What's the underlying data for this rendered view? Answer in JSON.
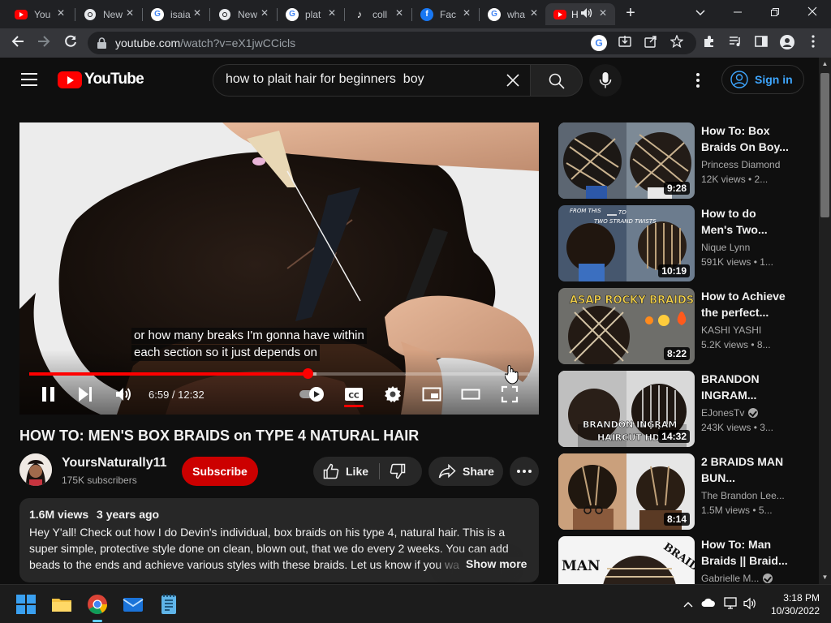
{
  "browser": {
    "tabs": [
      {
        "title": "You",
        "icon": "youtube-icon",
        "color": "#ff0000"
      },
      {
        "title": "New",
        "icon": "chrome-icon",
        "color": "#ffffff"
      },
      {
        "title": "isaia",
        "icon": "google-icon",
        "color": "#ffffff"
      },
      {
        "title": "New",
        "icon": "chrome-icon",
        "color": "#ffffff"
      },
      {
        "title": "plat",
        "icon": "google-icon",
        "color": "#ffffff"
      },
      {
        "title": "coll",
        "icon": "tiktok-icon",
        "color": "#ffffff"
      },
      {
        "title": "Fac",
        "icon": "facebook-icon",
        "color": "#1877f2"
      },
      {
        "title": "wha",
        "icon": "google-icon",
        "color": "#ffffff"
      },
      {
        "title": "H",
        "icon": "youtube-icon",
        "color": "#ff0000",
        "active": true
      }
    ],
    "url_host": "youtube.com",
    "url_path": "/watch?v=eX1jwCCicls"
  },
  "youtube": {
    "logo_text": "YouTube",
    "search_value": "how to plait hair for beginners  boy",
    "sign_in": "Sign in"
  },
  "player": {
    "caption_line1": "or how many breaks I'm gonna have within",
    "caption_line2": "each section so it just depends on",
    "current_time": "6:59",
    "duration": "12:32",
    "time_display": "6:59 / 12:32",
    "played_fraction": 0.557,
    "loaded_fraction": 0.575
  },
  "video": {
    "title": "HOW TO: MEN'S BOX BRAIDS on TYPE 4 NATURAL HAIR",
    "channel": "YoursNaturally11",
    "subscribers": "175K subscribers",
    "subscribe_label": "Subscribe",
    "like_label": "Like",
    "share_label": "Share",
    "views": "1.6M views",
    "age": "3 years ago",
    "description": "Hey Y'all! Check out how I do Devin's individual, box braids on his type 4, natural hair. This is a super simple, protective style done on clean, blown out, that we do every 2 weeks. You can add beads to the ends and achieve various styles with these braids. Let us know if you want to see h",
    "show_more": "Show more"
  },
  "recommendations": [
    {
      "title": "How To: Box Braids On Boy...",
      "channel": "Princess Diamond",
      "stats": "12K views  • 2...",
      "duration": "9:28",
      "verified": false
    },
    {
      "title": "How to do Men's Two...",
      "channel": "Nique Lynn",
      "stats": "591K views  • 1...",
      "duration": "10:19",
      "verified": false,
      "thumb_text1": "FROM THIS",
      "thumb_text2": "TO",
      "thumb_text3": "TWO STRAND TWISTS"
    },
    {
      "title": "How to Achieve the perfect...",
      "channel": "KASHI YASHI",
      "stats": "5.2K views  • 8...",
      "duration": "8:22",
      "verified": false,
      "thumb_text1": "ASAP ROCKY BRAIDS"
    },
    {
      "title": "BRANDON INGRAM...",
      "channel": "EJonesTv",
      "stats": "243K views  • 3...",
      "duration": "14:32",
      "verified": true,
      "thumb_text1": "BRANDON INGRAM",
      "thumb_text2": "HAIRCUT HD !"
    },
    {
      "title": "2 BRAIDS MAN BUN...",
      "channel": "The Brandon Lee...",
      "stats": "1.5M views  • 5...",
      "duration": "8:14",
      "verified": false
    },
    {
      "title": "How To: Man Braids || Braid...",
      "channel": "Gabrielle M...",
      "stats": "",
      "duration": "",
      "verified": true,
      "thumb_text1": "MAN",
      "thumb_text2": "BRAIDS"
    }
  ],
  "taskbar": {
    "time": "3:18 PM",
    "date": "10/30/2022"
  }
}
